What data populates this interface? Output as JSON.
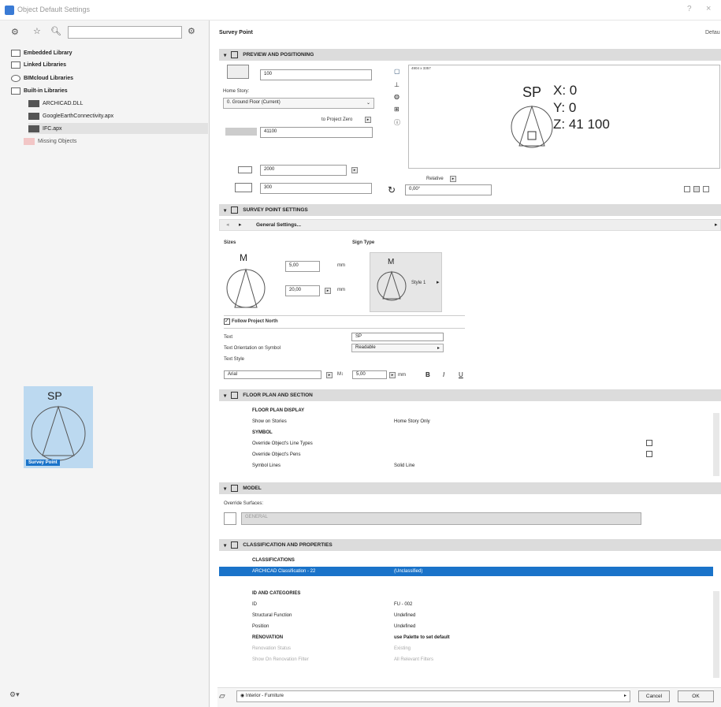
{
  "window": {
    "title": "Object Default Settings",
    "help": "?",
    "close": "×"
  },
  "left": {
    "tree": [
      {
        "label": "Embedded Library",
        "bold": true
      },
      {
        "label": "Linked Libraries",
        "bold": true
      },
      {
        "label": "BIMcloud Libraries",
        "bold": true
      },
      {
        "label": "Built-in Libraries",
        "bold": true
      },
      {
        "label": "ARCHICAD.DLL",
        "bold": false
      },
      {
        "label": "GoogleEarthConnectivity.apx",
        "bold": false
      },
      {
        "label": "IFC.apx",
        "bold": false
      },
      {
        "label": "Missing Objects",
        "bold": false
      }
    ],
    "thumb_text": "SP",
    "thumb_label": "Survey Point"
  },
  "header": {
    "title": "Survey Point",
    "right": "Defau"
  },
  "preview_section": {
    "title": "PREVIEW AND POSITIONING",
    "elevation_value": "100",
    "home_story_label": "Home Story:",
    "home_story_value": "0. Ground Floor (Current)",
    "to_project_zero": "to Project Zero",
    "project_zero_value": "41100",
    "width_value": "2000",
    "height_value": "300",
    "angle_value": "0,00°",
    "relative_label": "Relative",
    "preview_size": "4904 x 3357",
    "preview_sp": "SP",
    "coord_x": "X: 0",
    "coord_y": "Y: 0",
    "coord_z": "Z: 41 100"
  },
  "settings_section": {
    "title": "SURVEY POINT SETTINGS",
    "general": "General Settings...",
    "sizes_label": "Sizes",
    "sign_type_label": "Sign Type",
    "m_letter": "M",
    "size1": "5,00",
    "size2": "20,00",
    "unit": "mm",
    "style_label": "Style 1",
    "follow_north": "Follow Project North",
    "text_label": "Text",
    "text_value": "SP",
    "orientation_label": "Text Orientation on Symbol",
    "orientation_value": "Readable",
    "text_style_label": "Text Style",
    "font_value": "Arial",
    "font_size": "5,00",
    "font_unit": "mm",
    "bold_btn": "B",
    "italic_btn": "I",
    "underline_btn": "U"
  },
  "floor_section": {
    "title": "FLOOR PLAN AND SECTION",
    "rows": [
      {
        "name": "FLOOR PLAN DISPLAY",
        "value": "",
        "bold": true
      },
      {
        "name": "Show on Stories",
        "value": "Home Story Only",
        "bold": false
      },
      {
        "name": "SYMBOL",
        "value": "",
        "bold": true
      },
      {
        "name": "Override Object's Line Types",
        "value": "",
        "bold": false
      },
      {
        "name": "Override Object's Pens",
        "value": "",
        "bold": false
      },
      {
        "name": "Symbol Lines",
        "value": "Solid Line",
        "bold": false
      }
    ]
  },
  "model_section": {
    "title": "MODEL",
    "override_label": "Override Surfaces:",
    "surface_value": "GENERAL"
  },
  "class_section": {
    "title": "CLASSIFICATION AND PROPERTIES",
    "classifications": "CLASSIFICATIONS",
    "class_name": "ARCHICAD Classification - 22",
    "class_value": "(Unclassified)",
    "id_categories": "ID AND CATEGORIES",
    "rows": [
      {
        "name": "ID",
        "value": "FU - 002"
      },
      {
        "name": "Structural Function",
        "value": "Undefined"
      },
      {
        "name": "Position",
        "value": "Undefined"
      }
    ],
    "renovation": "RENOVATION",
    "renovation_value": "use Palette to set default",
    "reno_rows": [
      {
        "name": "Renovation Status",
        "value": "Existing"
      },
      {
        "name": "Show On Renovation Filter",
        "value": "All Relevant Filters"
      }
    ]
  },
  "footer": {
    "layer": "Interior - Furniture",
    "cancel": "Cancel",
    "ok": "OK"
  }
}
